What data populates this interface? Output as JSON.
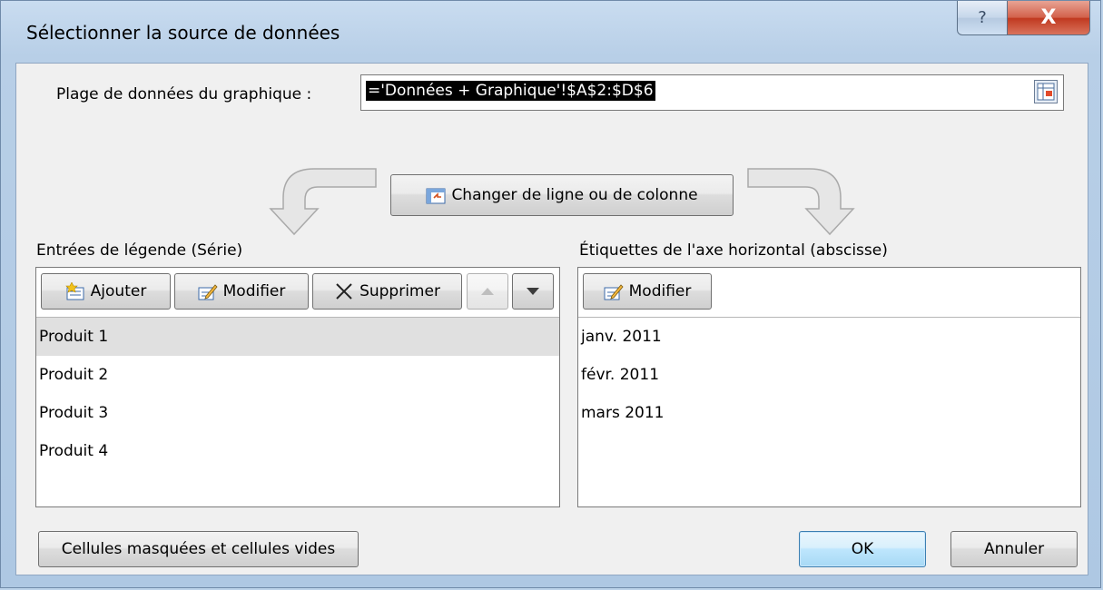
{
  "dialog": {
    "title": "Sélectionner la source de données",
    "help_glyph": "?",
    "close_glyph": "X"
  },
  "range": {
    "label": "Plage de données du graphique :",
    "value": "='Données + Graphique'!$A$2:$D$6"
  },
  "switch_button": {
    "label": "Changer de ligne ou de colonne"
  },
  "legend": {
    "title": "Entrées de légende (Série)",
    "add_label": "Ajouter",
    "edit_label": "Modifier",
    "delete_label": "Supprimer",
    "items": [
      {
        "label": "Produit 1",
        "selected": true
      },
      {
        "label": "Produit 2",
        "selected": false
      },
      {
        "label": "Produit 3",
        "selected": false
      },
      {
        "label": "Produit 4",
        "selected": false
      }
    ]
  },
  "axis": {
    "title": "Étiquettes de l'axe horizontal (abscisse)",
    "edit_label": "Modifier",
    "items": [
      {
        "label": "janv. 2011"
      },
      {
        "label": "févr. 2011"
      },
      {
        "label": "mars 2011"
      }
    ]
  },
  "footer": {
    "hidden_cells_label": "Cellules masquées et cellules vides",
    "ok_label": "OK",
    "cancel_label": "Annuler"
  },
  "colors": {
    "titlebar": "#b8cfe7",
    "close_button": "#c0381f",
    "selection_highlight": "#e0e0e0",
    "ok_button": "#bee6fd"
  }
}
